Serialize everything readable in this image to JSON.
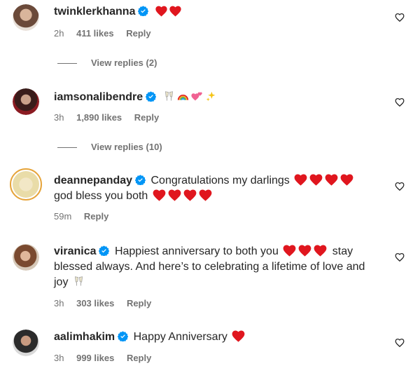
{
  "comments": [
    {
      "username": "twinklerkhanna",
      "text": "",
      "emojis": [
        "red-heart",
        "red-heart"
      ],
      "time": "2h",
      "likes": "411 likes",
      "reply": "Reply",
      "view_replies": "View replies (2)"
    },
    {
      "username": "iamsonalibendre",
      "text": "",
      "emojis": [
        "clinking-glasses",
        "rainbow",
        "two-hearts",
        "sparkles"
      ],
      "time": "3h",
      "likes": "1,890 likes",
      "reply": "Reply",
      "view_replies": "View replies (10)"
    },
    {
      "username": "deannepanday",
      "text_line1": "Congratulations my darlings",
      "text_line2": "god bless you both",
      "emojis_line1": [
        "red-heart",
        "red-heart",
        "red-heart",
        "red-heart"
      ],
      "emojis_line2": [
        "red-heart",
        "red-heart",
        "red-heart",
        "red-heart"
      ],
      "time": "59m",
      "reply": "Reply"
    },
    {
      "username": "viranica",
      "text_line1_a": "Happiest anniversary to both you",
      "text_line1_b": "stay",
      "text_line2": "blessed always. And here’s to celebrating a lifetime of love and",
      "text_line3": "joy",
      "emojis_line1": [
        "red-heart",
        "red-heart",
        "red-heart"
      ],
      "emojis_line3": [
        "clinking-glasses"
      ],
      "time": "3h",
      "likes": "303 likes",
      "reply": "Reply"
    },
    {
      "username": "aalimhakim",
      "text": "Happy Anniversary",
      "emojis": [
        "red-heart"
      ],
      "time": "3h",
      "likes": "999 likes",
      "reply": "Reply"
    }
  ],
  "colors": {
    "verified": "#0095f6",
    "heart": "#e0161e",
    "meta": "#737373",
    "text": "#262626"
  }
}
